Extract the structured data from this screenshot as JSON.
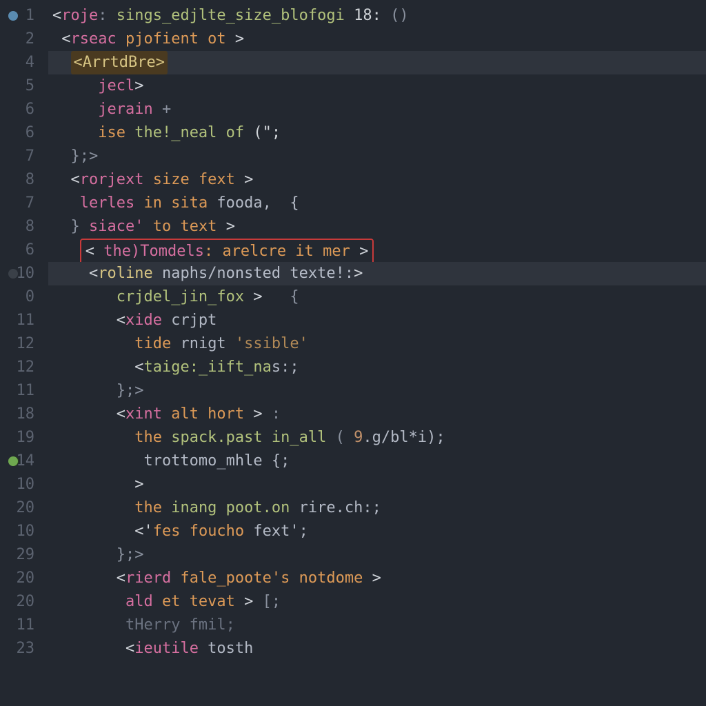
{
  "gutter": [
    {
      "n": "1",
      "icon": "blue"
    },
    {
      "n": "2"
    },
    {
      "n": "4"
    },
    {
      "n": "5"
    },
    {
      "n": "6"
    },
    {
      "n": "6"
    },
    {
      "n": "7"
    },
    {
      "n": "8"
    },
    {
      "n": "7"
    },
    {
      "n": "8"
    },
    {
      "n": "6"
    },
    {
      "n": "10",
      "icon": "dark"
    },
    {
      "n": "0"
    },
    {
      "n": "11"
    },
    {
      "n": "12"
    },
    {
      "n": "12"
    },
    {
      "n": "11"
    },
    {
      "n": "18"
    },
    {
      "n": "19"
    },
    {
      "n": "14",
      "icon": "green"
    },
    {
      "n": "10"
    },
    {
      "n": "20"
    },
    {
      "n": "10"
    },
    {
      "n": "29"
    },
    {
      "n": "20"
    },
    {
      "n": "20"
    },
    {
      "n": "11"
    },
    {
      "n": "23"
    }
  ],
  "lines": {
    "l1": {
      "a": "<",
      "b": "roje",
      "c": ": ",
      "d": "sings_edjlte_size_blofogi",
      "e": " 18: ",
      "f": "()"
    },
    "l2": {
      "a": "<",
      "b": "rseac",
      "c": " pjofient ot ",
      "d": ">"
    },
    "l3": {
      "tag": "<ArrtdBre>"
    },
    "l4": {
      "a": "jecl",
      "b": ">"
    },
    "l5": {
      "a": "jerain",
      "b": " +"
    },
    "l6": {
      "a": "ise ",
      "b": "the!_neal of",
      "c": " (\";"
    },
    "l7": {
      "a": "};>"
    },
    "l8": {
      "a": "<",
      "b": "rorjext",
      "c": " size fext ",
      "d": ">"
    },
    "l9": {
      "a": "lerles ",
      "b": "in sita",
      "c": " fooda,  {"
    },
    "l10": {
      "a": "} ",
      "b": "siace'",
      "c": " to text ",
      "d": ">"
    },
    "l11": {
      "a": "< ",
      "b": "the)Tomdels",
      "c": ": arelcre it mer ",
      "d": ">"
    },
    "l12": {
      "a": "<",
      "b": "roline",
      "c": " naphs/nonsted texte!:",
      "d": ">"
    },
    "l13": {
      "a": "crjdel_jin_fox ",
      "b": ">",
      "c": "   {"
    },
    "l14": {
      "a": "<",
      "b": "xide",
      "c": " crjpt"
    },
    "l15": {
      "a": "tide ",
      "b": "rnigt ",
      "c": "'ssible'"
    },
    "l16": {
      "a": "<",
      "b": "taige:_iift_na",
      "c": "s:;"
    },
    "l17": {
      "a": "};>"
    },
    "l18": {
      "a": "<",
      "b": "xint",
      "c": " alt hort ",
      "d": ">",
      "e": " :"
    },
    "l19": {
      "a": "the ",
      "b": "spack.past in_all",
      "c": " ( ",
      "d": "9",
      "e": ".g/bl*i);"
    },
    "l20": {
      "a": "trottomo_mhle {;"
    },
    "l21": {
      "a": ">"
    },
    "l22": {
      "a": "the ",
      "b": "inang poot.on",
      "c": " rire.ch:;"
    },
    "l23": {
      "a": "<'",
      "b": "fes foucho",
      "c": " fext';"
    },
    "l24": {
      "a": "};>"
    },
    "l25": {
      "a": "<",
      "b": "rierd",
      "c": " fale_poote's notdome ",
      "d": ">"
    },
    "l26": {
      "a": "ald ",
      "b": "et tevat ",
      "c": ">",
      "d": " [;"
    },
    "l27": {
      "a": "tHerry fmil;"
    },
    "l28": {
      "a": "<",
      "b": "ieutile",
      "c": " tosth"
    }
  }
}
